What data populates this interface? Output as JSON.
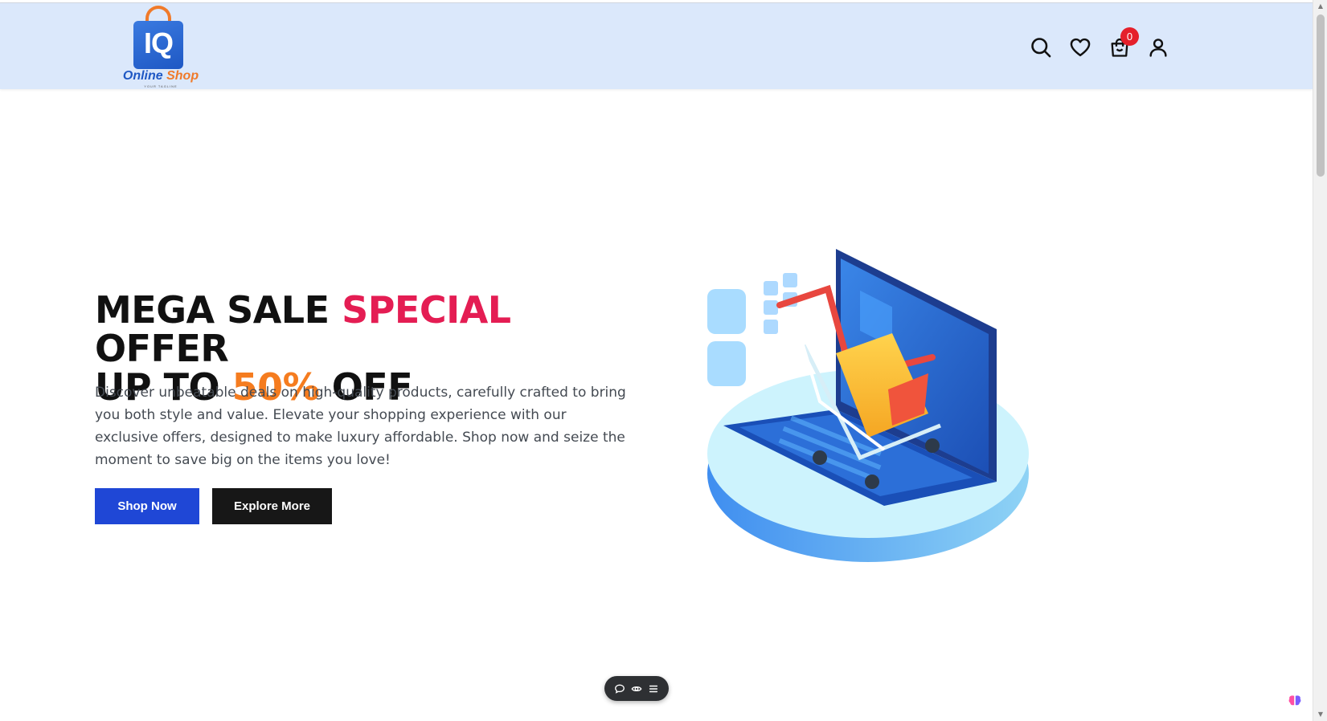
{
  "header": {
    "logo": {
      "monogram": "IQ",
      "name_part1": "Online",
      "name_part2": "Shop",
      "tagline": "YOUR TAGLINE"
    },
    "icons": [
      "search-icon",
      "heart-icon",
      "cart-icon",
      "user-icon"
    ],
    "cart_count": "0"
  },
  "hero": {
    "title_line1_part1": "MEGA SALE ",
    "title_line1_highlight": "SPECIAL",
    "title_line1_part2": " OFFER",
    "title_line2_part1": "UP TO ",
    "title_line2_highlight": "50%",
    "title_line2_part2": " OFF",
    "description": "Discover unbeatable deals on high-quality products, carefully crafted to bring you both style and value. Elevate your shopping experience with our exclusive offers, designed to make luxury affordable. Shop now and seize the moment to save big on the items you love!",
    "primary_button": "Shop Now",
    "secondary_button": "Explore More"
  },
  "colors": {
    "header_bg": "#dbe8fb",
    "highlight_red": "#e41d53",
    "highlight_orange": "#f57c1f",
    "primary_button": "#1f47d6",
    "secondary_button": "#171717",
    "badge": "#e5202b"
  },
  "floating_toolbar": {
    "icons": [
      "comment-icon",
      "eye-icon",
      "menu-icon"
    ]
  }
}
